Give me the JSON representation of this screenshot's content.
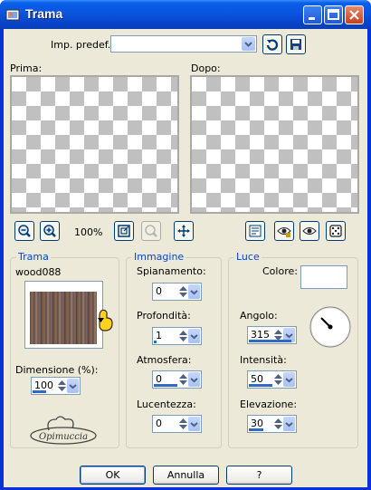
{
  "window": {
    "title": "Trama",
    "icon": "app-icon",
    "controls": [
      "minimize-icon",
      "maximize-icon",
      "close-icon"
    ]
  },
  "presets": {
    "label": "Imp. predef.:",
    "value": ""
  },
  "preview": {
    "before_label": "Prima:",
    "after_label": "Dopo:",
    "zoom": "100%"
  },
  "texture_group": {
    "title": "Trama",
    "texture_name": "wood088",
    "size_label": "Dimensione (%):",
    "size_value": "100",
    "size_fill": 0.3
  },
  "image_group": {
    "title": "Immagine",
    "smoothness_label": "Spianamento:",
    "smoothness_value": "0",
    "depth_label": "Profondità:",
    "depth_value": "1",
    "ambience_label": "Atmosfera:",
    "ambience_value": "0",
    "shininess_label": "Lucentezza:",
    "shininess_value": "0"
  },
  "light_group": {
    "title": "Luce",
    "color_label": "Colore:",
    "color_value": "#ffffff",
    "angle_label": "Angolo:",
    "angle_value": "315",
    "intensity_label": "Intensità:",
    "intensity_value": "50",
    "elevation_label": "Elevazione:",
    "elevation_value": "30"
  },
  "watermark": "Opimuccia",
  "buttons": {
    "ok": "OK",
    "cancel": "Annulla",
    "help": "?"
  },
  "colors": {
    "titlebar": "#0a55df",
    "dialog_bg": "#ece9d8",
    "group_title": "#0046d5",
    "slider_fill": "#316ac5"
  }
}
